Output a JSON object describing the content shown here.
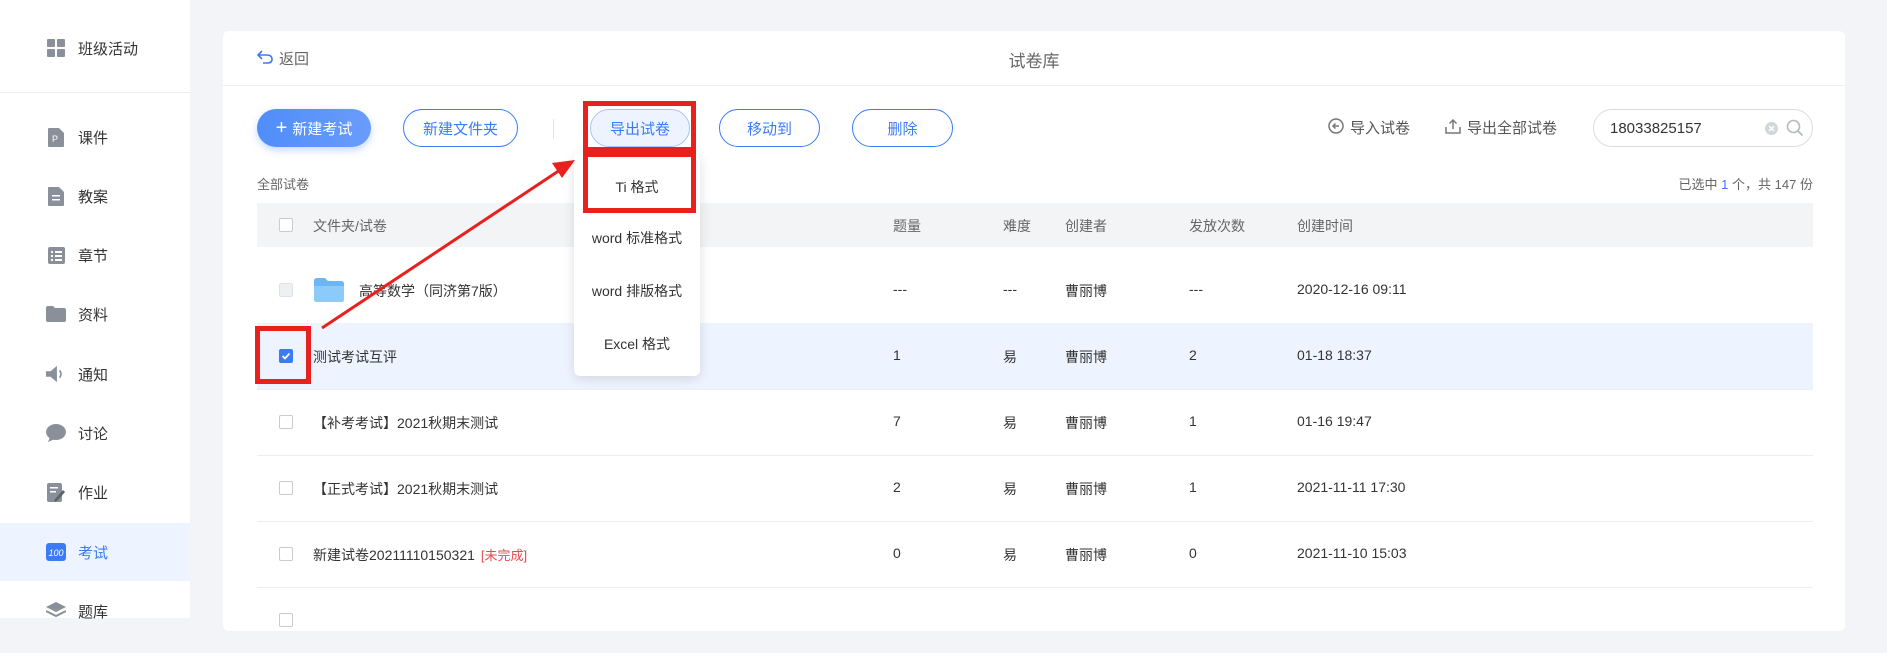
{
  "sidebar": {
    "items": [
      {
        "label": "班级活动",
        "icon": "grid-icon"
      },
      {
        "label": "课件",
        "icon": "ppt-file-icon"
      },
      {
        "label": "教案",
        "icon": "lesson-plan-icon"
      },
      {
        "label": "章节",
        "icon": "list-icon"
      },
      {
        "label": "资料",
        "icon": "folder-icon"
      },
      {
        "label": "通知",
        "icon": "speaker-icon"
      },
      {
        "label": "讨论",
        "icon": "chat-icon"
      },
      {
        "label": "作业",
        "icon": "homework-icon"
      },
      {
        "label": "考试",
        "icon": "exam-100-icon"
      },
      {
        "label": "题库",
        "icon": "stack-icon"
      }
    ],
    "active_index": 8,
    "accent_color": "#3b7bf6"
  },
  "header": {
    "back_label": "返回",
    "title": "试卷库"
  },
  "toolbar": {
    "new_exam": "新建考试",
    "new_folder": "新建文件夹",
    "export": "导出试卷",
    "move_to": "移动到",
    "delete": "删除",
    "import": "导入试卷",
    "export_all": "导出全部试卷"
  },
  "search": {
    "value": "18033825157",
    "placeholder": ""
  },
  "export_menu": {
    "options": [
      "Ti 格式",
      "word 标准格式",
      "word 排版格式",
      "Excel 格式"
    ]
  },
  "breadcrumb": "全部试卷",
  "summary": {
    "prefix": "已选中",
    "selected": "1",
    "middle": "个，共",
    "total": "147",
    "suffix": "份"
  },
  "table": {
    "columns": [
      "文件夹/试卷",
      "题量",
      "难度",
      "创建者",
      "发放次数",
      "创建时间"
    ],
    "rows": [
      {
        "name": "高等数学（同济第7版）",
        "type": "folder",
        "count": "---",
        "difficulty": "---",
        "creator": "曹丽博",
        "issued": "---",
        "created": "2020-12-16 09:11",
        "checked": false,
        "tag": ""
      },
      {
        "name": "测试考试互评",
        "type": "paper",
        "count": "1",
        "difficulty": "易",
        "creator": "曹丽博",
        "issued": "2",
        "created": "01-18 18:37",
        "checked": true,
        "tag": ""
      },
      {
        "name": "【补考考试】2021秋期末测试",
        "type": "paper",
        "count": "7",
        "difficulty": "易",
        "creator": "曹丽博",
        "issued": "1",
        "created": "01-16 19:47",
        "checked": false,
        "tag": ""
      },
      {
        "name": "【正式考试】2021秋期末测试",
        "type": "paper",
        "count": "2",
        "difficulty": "易",
        "creator": "曹丽博",
        "issued": "1",
        "created": "2021-11-11 17:30",
        "checked": false,
        "tag": ""
      },
      {
        "name": "新建试卷20211110150321",
        "type": "paper",
        "count": "0",
        "difficulty": "易",
        "creator": "曹丽博",
        "issued": "0",
        "created": "2021-11-10 15:03",
        "checked": false,
        "tag": "[未完成]"
      }
    ]
  },
  "colors": {
    "accent": "#3b7bf6",
    "annotation": "#e8211e",
    "incomplete_tag": "#e84a4a"
  }
}
